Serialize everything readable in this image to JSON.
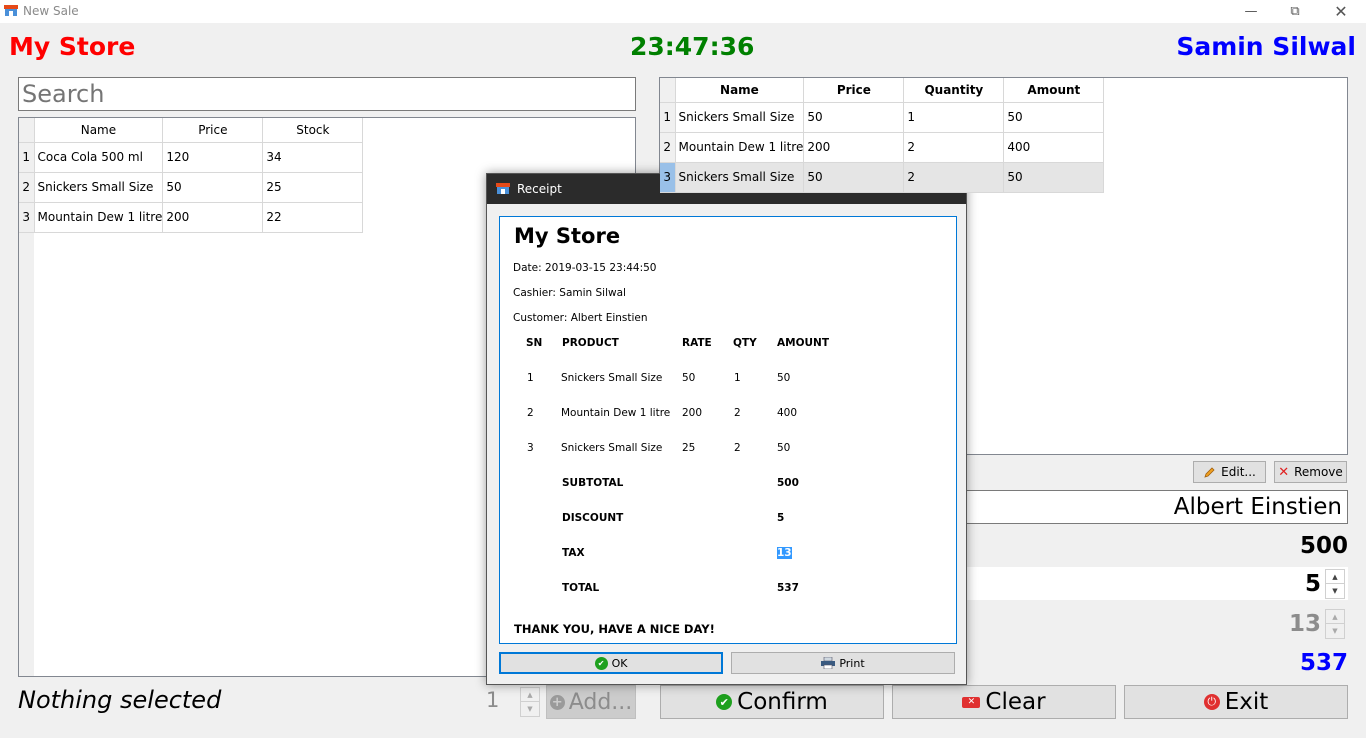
{
  "window": {
    "title": "New Sale"
  },
  "header": {
    "store": "My Store",
    "clock": "23:47:36",
    "user": "Samin Silwal"
  },
  "search": {
    "placeholder": "Search"
  },
  "products": {
    "columns": [
      "Name",
      "Price",
      "Stock"
    ],
    "rows": [
      {
        "n": "1",
        "name": "Coca Cola 500 ml",
        "price": "120",
        "stock": "34"
      },
      {
        "n": "2",
        "name": "Snickers Small Size",
        "price": "50",
        "stock": "25"
      },
      {
        "n": "3",
        "name": "Mountain Dew 1 litre",
        "price": "200",
        "stock": "22"
      }
    ]
  },
  "cart": {
    "columns": [
      "Name",
      "Price",
      "Quantity",
      "Amount"
    ],
    "rows": [
      {
        "n": "1",
        "name": "Snickers Small Size",
        "price": "50",
        "qty": "1",
        "amount": "50"
      },
      {
        "n": "2",
        "name": "Mountain Dew 1 litre",
        "price": "200",
        "qty": "2",
        "amount": "400"
      },
      {
        "n": "3",
        "name": "Snickers Small Size",
        "price": "50",
        "qty": "2",
        "amount": "50"
      }
    ]
  },
  "actions": {
    "edit": "Edit...",
    "remove": "Remove"
  },
  "customer": {
    "value": "Albert Einstien"
  },
  "totals": {
    "subtotal": "500",
    "discount": "5",
    "tax": "13",
    "total": "537"
  },
  "bottom": {
    "status": "Nothing selected",
    "qty": "1",
    "add": "Add...",
    "confirm": "Confirm",
    "clear": "Clear",
    "exit": "Exit"
  },
  "receipt": {
    "title": "Receipt",
    "help": "?",
    "store": "My Store",
    "date": "Date: 2019-03-15 23:44:50",
    "cashier": "Cashier: Samin Silwal",
    "customer": "Customer: Albert Einstien",
    "headers": {
      "sn": "SN",
      "product": "PRODUCT",
      "rate": "RATE",
      "qty": "QTY",
      "amount": "AMOUNT"
    },
    "items": [
      {
        "sn": "1",
        "product": "Snickers Small Size",
        "rate": "50",
        "qty": "1",
        "amount": "50"
      },
      {
        "sn": "2",
        "product": "Mountain Dew 1 litre",
        "rate": "200",
        "qty": "2",
        "amount": "400"
      },
      {
        "sn": "3",
        "product": "Snickers Small Size",
        "rate": "25",
        "qty": "2",
        "amount": "50"
      }
    ],
    "subtotal_label": "SUBTOTAL",
    "subtotal": "500",
    "discount_label": "DISCOUNT",
    "discount": "5",
    "tax_label": "TAX",
    "tax": "13",
    "total_label": "TOTAL",
    "total": "537",
    "footer": "THANK YOU, HAVE A NICE DAY!",
    "ok": "OK",
    "print": "Print"
  },
  "colors": {
    "store": "#ff0000",
    "clock": "#008000",
    "user": "#0000ff",
    "total": "#0000ff",
    "selection": "#3399ff"
  }
}
